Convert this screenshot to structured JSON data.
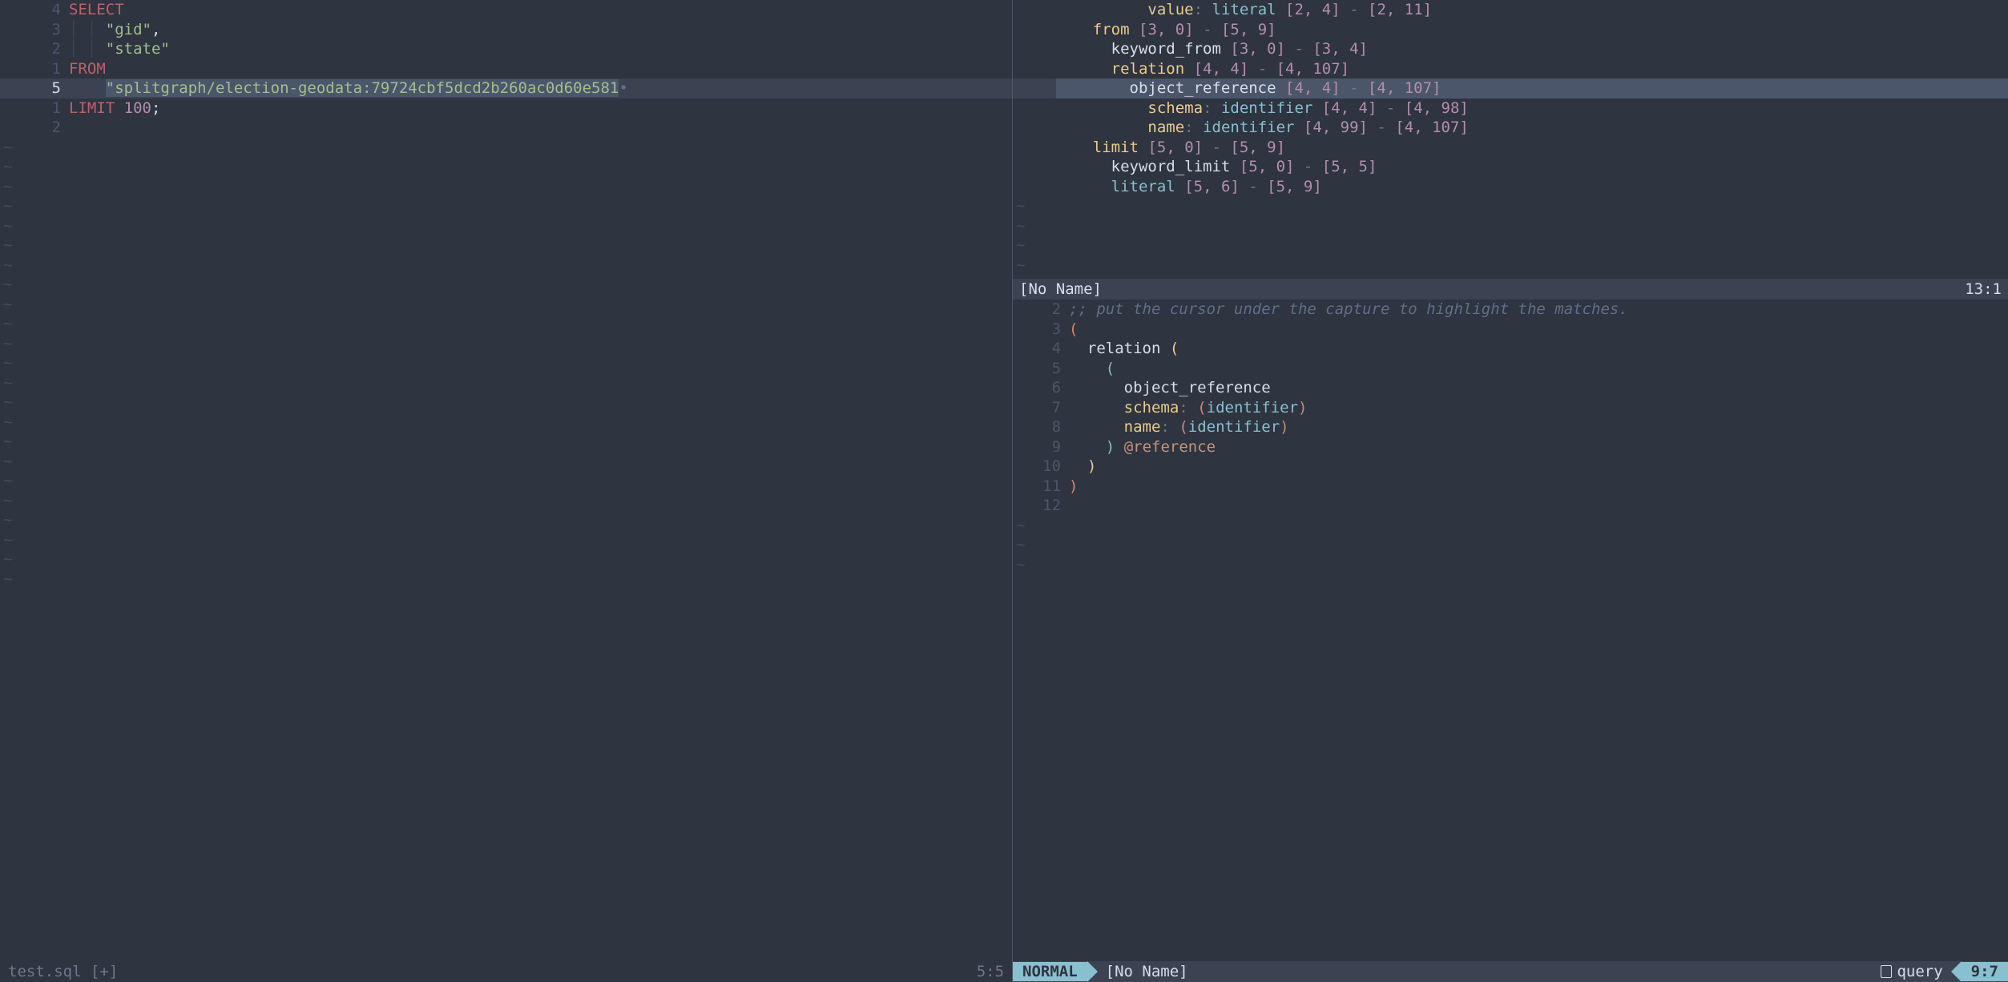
{
  "left": {
    "filename": "test.sql",
    "modified_marker": "[+]",
    "cursor_pos": "5:5",
    "lines": [
      {
        "num": "4",
        "current": false,
        "tokens": [
          [
            "kw-red",
            "SELECT"
          ]
        ]
      },
      {
        "num": "3",
        "current": false,
        "tokens": [
          [
            "indent",
            "│ │ "
          ],
          [
            "str",
            "\"gid\""
          ],
          [
            "ident",
            ","
          ]
        ]
      },
      {
        "num": "2",
        "current": false,
        "tokens": [
          [
            "indent",
            "│ │ "
          ],
          [
            "str",
            "\"state\""
          ]
        ]
      },
      {
        "num": "1",
        "current": false,
        "tokens": [
          [
            "kw-red",
            "FROM"
          ]
        ]
      },
      {
        "num": "5",
        "current": true,
        "hl": true,
        "tokens": [
          [
            "indent",
            "│ │ "
          ],
          [
            "hlstr",
            "\"splitgraph/election-geodata:79724cbf5dcd2b260ac0d60e581"
          ],
          [
            "trunc",
            "•"
          ]
        ]
      },
      {
        "num": "1",
        "current": false,
        "tokens": [
          [
            "kw-red",
            "LIMIT"
          ],
          [
            "ident",
            " "
          ],
          [
            "num",
            "100"
          ],
          [
            "ident",
            ";"
          ]
        ]
      },
      {
        "num": "2",
        "current": false,
        "tokens": []
      }
    ],
    "tilde_count": 23
  },
  "top_right": {
    "title": "[No Name]",
    "cursor_pos": "13:1",
    "lines": [
      {
        "tokens": [
          [
            "dim",
            "          "
          ],
          [
            "yellow",
            "value"
          ],
          [
            "dim",
            ": "
          ],
          [
            "teal",
            "literal"
          ],
          [
            "dim",
            " "
          ],
          [
            "purple",
            "[2, 4]"
          ],
          [
            "dim",
            " - "
          ],
          [
            "purple",
            "[2, 11]"
          ]
        ]
      },
      {
        "tokens": [
          [
            "dim",
            "    "
          ],
          [
            "yellow",
            "from"
          ],
          [
            "dim",
            " "
          ],
          [
            "purple",
            "[3, 0]"
          ],
          [
            "dim",
            " - "
          ],
          [
            "purple",
            "[5, 9]"
          ]
        ]
      },
      {
        "tokens": [
          [
            "dim",
            "      "
          ],
          [
            "ident",
            "keyword_from"
          ],
          [
            "dim",
            " "
          ],
          [
            "purple",
            "[3, 0]"
          ],
          [
            "dim",
            " - "
          ],
          [
            "purple",
            "[3, 4]"
          ]
        ]
      },
      {
        "tokens": [
          [
            "dim",
            "      "
          ],
          [
            "yellow",
            "relation"
          ],
          [
            "dim",
            " "
          ],
          [
            "purple",
            "[4, 4]"
          ],
          [
            "dim",
            " - "
          ],
          [
            "purple",
            "[4, 107]"
          ]
        ]
      },
      {
        "hl": true,
        "tokens": [
          [
            "dim",
            "        "
          ],
          [
            "ident",
            "object_reference"
          ],
          [
            "dim",
            " "
          ],
          [
            "purple",
            "[4, 4]"
          ],
          [
            "dim",
            " - "
          ],
          [
            "purple",
            "[4, 107]"
          ]
        ]
      },
      {
        "tokens": [
          [
            "dim",
            "          "
          ],
          [
            "yellow",
            "schema"
          ],
          [
            "dim",
            ": "
          ],
          [
            "teal",
            "identifier"
          ],
          [
            "dim",
            " "
          ],
          [
            "purple",
            "[4, 4]"
          ],
          [
            "dim",
            " - "
          ],
          [
            "purple",
            "[4, 98]"
          ]
        ]
      },
      {
        "tokens": [
          [
            "dim",
            "          "
          ],
          [
            "yellow",
            "name"
          ],
          [
            "dim",
            ": "
          ],
          [
            "teal",
            "identifier"
          ],
          [
            "dim",
            " "
          ],
          [
            "purple",
            "[4, 99]"
          ],
          [
            "dim",
            " - "
          ],
          [
            "purple",
            "[4, 107]"
          ]
        ]
      },
      {
        "tokens": [
          [
            "dim",
            "    "
          ],
          [
            "yellow",
            "limit"
          ],
          [
            "dim",
            " "
          ],
          [
            "purple",
            "[5, 0]"
          ],
          [
            "dim",
            " - "
          ],
          [
            "purple",
            "[5, 9]"
          ]
        ]
      },
      {
        "tokens": [
          [
            "dim",
            "      "
          ],
          [
            "ident",
            "keyword_limit"
          ],
          [
            "dim",
            " "
          ],
          [
            "purple",
            "[5, 0]"
          ],
          [
            "dim",
            " - "
          ],
          [
            "purple",
            "[5, 5]"
          ]
        ]
      },
      {
        "tokens": [
          [
            "dim",
            "      "
          ],
          [
            "teal",
            "literal"
          ],
          [
            "dim",
            " "
          ],
          [
            "purple",
            "[5, 6]"
          ],
          [
            "dim",
            " - "
          ],
          [
            "purple",
            "[5, 9]"
          ]
        ]
      }
    ],
    "tilde_count": 4
  },
  "bottom_right": {
    "title": "[No Name]",
    "filetype": "query",
    "cursor_pos": "9:7",
    "mode": "NORMAL",
    "lines": [
      {
        "num": "2",
        "tokens": [
          [
            "comment",
            ";; put the cursor under the capture to highlight the matches."
          ]
        ]
      },
      {
        "num": "3",
        "tokens": [
          [
            "orange",
            "("
          ]
        ]
      },
      {
        "num": "4",
        "tokens": [
          [
            "ident",
            "  relation "
          ],
          [
            "yellow",
            "("
          ]
        ]
      },
      {
        "num": "5",
        "tokens": [
          [
            "ident",
            "    "
          ],
          [
            "paren",
            "("
          ]
        ]
      },
      {
        "num": "6",
        "tokens": [
          [
            "ident",
            "      object_reference"
          ]
        ]
      },
      {
        "num": "7",
        "tokens": [
          [
            "ident",
            "      "
          ],
          [
            "yellow",
            "schema"
          ],
          [
            "dim",
            ": "
          ],
          [
            "orange",
            "("
          ],
          [
            "teal",
            "identifier"
          ],
          [
            "orange",
            ")"
          ]
        ]
      },
      {
        "num": "8",
        "tokens": [
          [
            "ident",
            "      "
          ],
          [
            "yellow",
            "name"
          ],
          [
            "dim",
            ": "
          ],
          [
            "orange",
            "("
          ],
          [
            "teal",
            "identifier"
          ],
          [
            "orange",
            ")"
          ]
        ]
      },
      {
        "num": "9",
        "tokens": [
          [
            "ident",
            "    "
          ],
          [
            "paren",
            ")"
          ],
          [
            "ident",
            " "
          ],
          [
            "at",
            "@reference"
          ]
        ]
      },
      {
        "num": "10",
        "tokens": [
          [
            "ident",
            "  "
          ],
          [
            "yellow",
            ")"
          ]
        ]
      },
      {
        "num": "11",
        "tokens": [
          [
            "orange",
            ")"
          ]
        ]
      },
      {
        "num": "12",
        "tokens": []
      }
    ],
    "tilde_count": 3
  }
}
